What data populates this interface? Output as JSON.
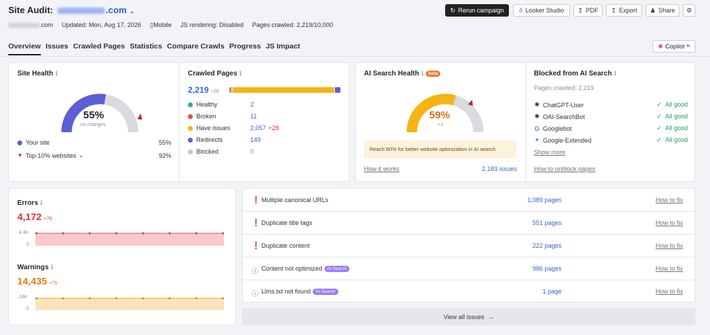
{
  "header": {
    "title_prefix": "Site Audit:",
    "title_domain": ".com",
    "chevron": "chevron-down-icon",
    "meta": {
      "domain": ".com",
      "updated": "Updated: Mon, Aug 17, 2026",
      "device": "Mobile",
      "js_rendering": "JS rendering: Disabled",
      "pages_crawled": "Pages crawled: 2,219/10,000"
    },
    "buttons": {
      "rerun": "Rerun campaign",
      "looker": "Looker Studio",
      "pdf": "PDF",
      "export": "Export",
      "share": "Share"
    }
  },
  "tabs": [
    "Overview",
    "Issues",
    "Crawled Pages",
    "Statistics",
    "Compare Crawls",
    "Progress",
    "JS Impact"
  ],
  "copilot": {
    "label": "Copilot",
    "sup": "AI"
  },
  "site_health": {
    "title": "Site Health",
    "value": "55%",
    "sub": "no changes",
    "percent": 55,
    "legend": [
      {
        "label": "Your site",
        "value": "55%",
        "color": "#5b5fd6"
      },
      {
        "label": "Top-10% websites",
        "value": "92%",
        "color": "#c0262f"
      }
    ]
  },
  "crawled_pages": {
    "title": "Crawled Pages",
    "total": "2,219",
    "delta": "+28",
    "bar": [
      {
        "share": 0.01,
        "color": "#e05252"
      },
      {
        "share": 0.01,
        "color": "#25b390"
      },
      {
        "share": 0.93,
        "color": "#f6b414"
      },
      {
        "share": 0.05,
        "color": "#5b5fd6"
      }
    ],
    "rows": [
      {
        "label": "Healthy",
        "value": "2",
        "delta": "",
        "color": "#25b390"
      },
      {
        "label": "Broken",
        "value": "11",
        "delta": "",
        "color": "#e05252"
      },
      {
        "label": "Have issues",
        "value": "2,057",
        "delta": "+28",
        "color": "#f6b414"
      },
      {
        "label": "Redirects",
        "value": "149",
        "delta": "",
        "color": "#5b5fd6"
      },
      {
        "label": "Blocked",
        "value": "0",
        "delta": "",
        "color": "#c5c8cf"
      }
    ]
  },
  "ai_health": {
    "title": "AI Search Health",
    "badge": "beta",
    "value": "59%",
    "delta": "+1",
    "percent": 59,
    "note": "Reach 80% for better website optimization in AI search",
    "link": "How it works",
    "issues": "2,183 issues"
  },
  "blocked_ai": {
    "title": "Blocked from AI Search",
    "sub": "Pages crawled: 2,219",
    "bots": [
      {
        "name": "ChatGPT-User",
        "status": "All good",
        "icon": "openai-icon"
      },
      {
        "name": "OAI-SearchBot",
        "status": "All good",
        "icon": "openai-icon"
      },
      {
        "name": "Googlebot",
        "status": "All good",
        "icon": "google-icon"
      },
      {
        "name": "Google-Extended",
        "status": "All good",
        "icon": "gemini-icon"
      }
    ],
    "more": "Show more",
    "link": "How to unblock pages"
  },
  "errors": {
    "title": "Errors",
    "value": "4,172",
    "delta": "+76",
    "ymax": "4.4K",
    "ymin": "0",
    "color": "#e05252"
  },
  "warnings": {
    "title": "Warnings",
    "value": "14,435",
    "delta": "+75",
    "ymax": "14K",
    "ymin": "0",
    "color": "#f0a02a"
  },
  "issues": [
    {
      "label": "Multiple canonical URLs",
      "count": "1,089 pages",
      "fix": "How to fix",
      "type": "error",
      "badge": ""
    },
    {
      "label": "Duplicate title tags",
      "count": "551 pages",
      "fix": "How to fix",
      "type": "error",
      "badge": ""
    },
    {
      "label": "Duplicate content",
      "count": "222 pages",
      "fix": "How to fix",
      "type": "error",
      "badge": ""
    },
    {
      "label": "Content not optimized",
      "count": "986 pages",
      "fix": "How to fix",
      "type": "notice",
      "badge": "AI Search"
    },
    {
      "label": "Llms.txt not found",
      "count": "1 page",
      "fix": "How to fix",
      "type": "notice",
      "badge": "AI Search"
    }
  ],
  "view_all": "View all issues"
}
